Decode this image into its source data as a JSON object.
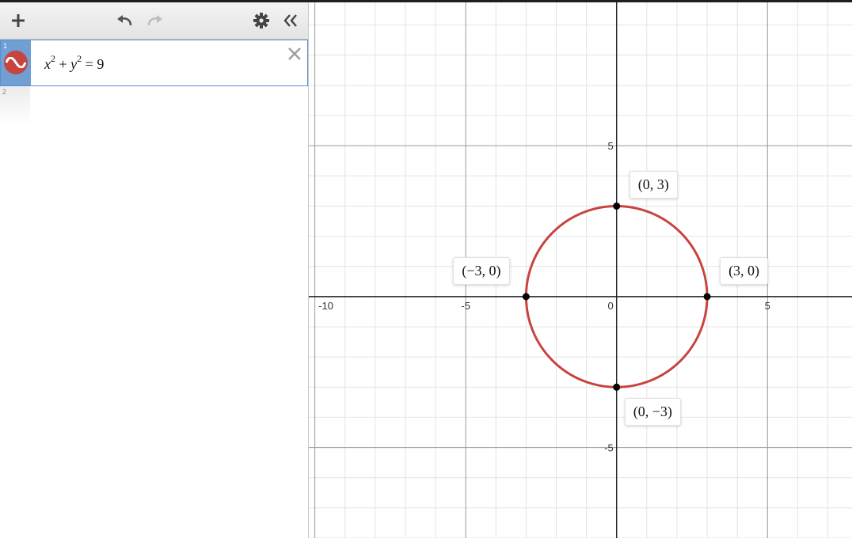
{
  "app": {
    "accent_color": "#c74440"
  },
  "toolbar": {
    "add_icon": "plus-icon",
    "undo_icon": "undo-icon",
    "redo_icon": "redo-icon",
    "settings_icon": "gear-icon",
    "collapse_icon": "double-chevron-left-icon"
  },
  "expressions": [
    {
      "index": "1",
      "latex_parts": {
        "x": "x",
        "x_exp": "2",
        "plus": " + ",
        "y": "y",
        "y_exp": "2",
        "eq": " = ",
        "rhs": "9"
      },
      "color": "#c74440",
      "icon": "wave-icon"
    },
    {
      "index": "2"
    }
  ],
  "graph": {
    "tick_labels_x": [
      "-10",
      "-5",
      "0",
      "5"
    ],
    "tick_labels_y": [
      "5",
      "-5"
    ],
    "point_labels": [
      "(0, 3)",
      "(−3, 0)",
      "(3, 0)",
      "(0, −3)"
    ]
  },
  "chart_data": {
    "type": "scatter",
    "equation": "x^2 + y^2 = 9",
    "curve": {
      "shape": "circle",
      "center": [
        0,
        0
      ],
      "radius": 3,
      "color": "#c74440"
    },
    "points": [
      {
        "x": 0,
        "y": 3,
        "label": "(0, 3)"
      },
      {
        "x": -3,
        "y": 0,
        "label": "(−3, 0)"
      },
      {
        "x": 3,
        "y": 0,
        "label": "(3, 0)"
      },
      {
        "x": 0,
        "y": -3,
        "label": "(0, −3)"
      }
    ],
    "xlim": [
      -10.2,
      7.8
    ],
    "ylim": [
      -8,
      9.75
    ],
    "grid": true,
    "major_step": 5,
    "minor_step": 1
  }
}
